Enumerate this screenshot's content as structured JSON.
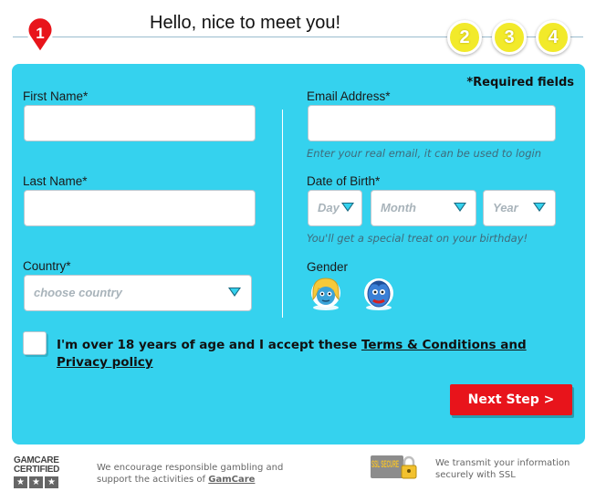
{
  "header": {
    "title": "Hello, nice to meet you!",
    "steps": [
      "1",
      "2",
      "3",
      "4"
    ],
    "current_step": "1"
  },
  "form": {
    "required_note": "*Required fields",
    "first_name": {
      "label": "First Name*",
      "value": ""
    },
    "last_name": {
      "label": "Last Name*",
      "value": ""
    },
    "country": {
      "label": "Country*",
      "placeholder": "choose country"
    },
    "email": {
      "label": "Email Address*",
      "value": "",
      "hint": "Enter your real email, it can be used to login"
    },
    "dob": {
      "label": "Date of Birth*",
      "day": "Day",
      "month": "Month",
      "year": "Year",
      "hint": "You'll get a special treat on your birthday!"
    },
    "gender": {
      "label": "Gender",
      "options": [
        "female-avatar-icon",
        "male-avatar-icon"
      ]
    },
    "terms": {
      "prefix": "I'm over 18 years of age and I accept these ",
      "link": "Terms & Conditions and Privacy policy",
      "checked": false
    },
    "next_button": "Next Step >"
  },
  "footer": {
    "gamcare_logo": "GAMCARE CERTIFIED",
    "gamcare_text": "We encourage responsible gambling and support the activities of ",
    "gamcare_link": "GamCare",
    "ssl_badge": "SSL SECURE",
    "ssl_text": "We transmit your information securely with SSL"
  },
  "colors": {
    "panel": "#35d2ee",
    "button": "#e8141b",
    "step_active": "#e8141b",
    "step_inactive": "#f2ea2a"
  }
}
